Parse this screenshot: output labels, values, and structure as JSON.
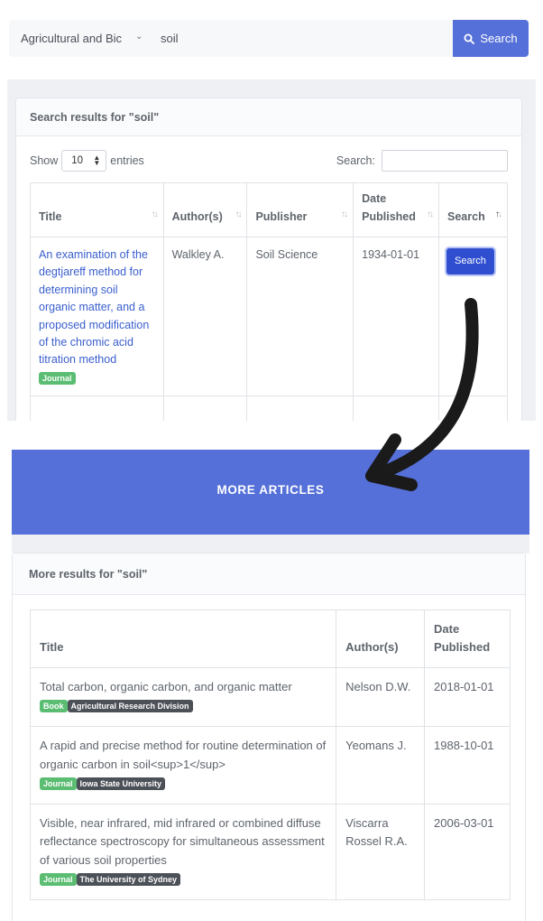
{
  "topbar": {
    "category": "Agricultural and Bic",
    "query": "soil",
    "search_label": "Search"
  },
  "results": {
    "header": "Search results for \"soil\"",
    "show_label": "Show",
    "entries_value": "10",
    "entries_label": "entries",
    "search_label": "Search:",
    "columns": [
      "Title",
      "Author(s)",
      "Publisher",
      "Date Published",
      "Search"
    ],
    "rows": [
      {
        "title": "An examination of the degtjareff method for determining soil organic matter, and a proposed modification of the chromic acid titration method",
        "type": "Journal",
        "author": "Walkley A.",
        "publisher": "Soil Science",
        "date": "1934-01-01",
        "button": "Search"
      }
    ]
  },
  "banner": {
    "label": "MORE ARTICLES"
  },
  "more": {
    "header": "More results for \"soil\"",
    "columns": [
      "Title",
      "Author(s)",
      "Date Published"
    ],
    "rows": [
      {
        "title": "Total carbon, organic carbon, and organic matter",
        "type": "Book",
        "publisher": "Agricultural Research Division",
        "author": "Nelson D.W.",
        "date": "2018-01-01"
      },
      {
        "title": "A rapid and precise method for routine determination of organic carbon in soil<sup>1</sup>",
        "type": "Journal",
        "publisher": "Iowa State University",
        "author": "Yeomans J.",
        "date": "1988-10-01"
      },
      {
        "title": "Visible, near infrared, mid infrared or combined diffuse reflectance spectroscopy for simultaneous assessment of various soil properties",
        "type": "Journal",
        "publisher": "The University of Sydney",
        "author": "Viscarra Rossel R.A.",
        "date": "2006-03-01"
      }
    ]
  },
  "colors": {
    "accent": "#5570d8",
    "button": "#2f4fd0",
    "link": "#3a5fcd",
    "badge_green": "#5bbd72",
    "badge_dark": "#4c5057"
  },
  "icons": {
    "top_search": "search-icon",
    "select": "chevron-down-icon",
    "sort": "sort-arrows-icon",
    "arrow": "curved-arrow-icon"
  }
}
